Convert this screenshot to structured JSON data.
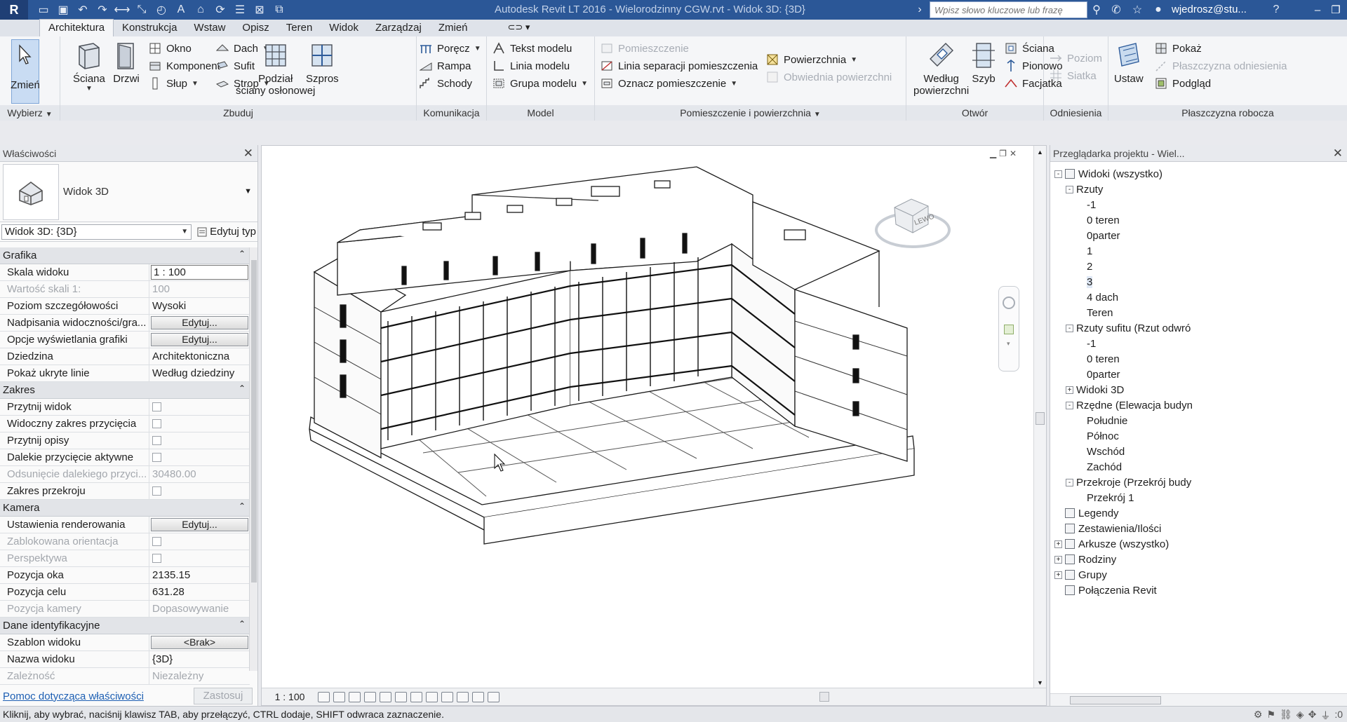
{
  "titlebar": {
    "logo": "R",
    "title": "Autodesk Revit LT 2016 -    Wielorodzinny CGW.rvt - Widok 3D: {3D}",
    "search_placeholder": "Wpisz słowo kluczowe lub frazę",
    "user": "wjedrosz@stu...",
    "quick_access_icons": [
      "open-icon",
      "save-icon",
      "undo-icon",
      "redo-icon",
      "measure-icon",
      "dimension-icon",
      "tag-icon",
      "text-icon",
      "3d-view-icon",
      "sync-icon",
      "thin-lines-icon",
      "close-hidden-icon",
      "switch-windows-icon"
    ],
    "help": "?"
  },
  "ribbon_tabs": [
    "Architektura",
    "Konstrukcja",
    "Wstaw",
    "Opisz",
    "Teren",
    "Widok",
    "Zarządzaj",
    "Zmień"
  ],
  "ribbon_tab_extra": "⊂⊃ ▾",
  "ribbon": {
    "select": {
      "modify_label": "Zmień",
      "group_label": "Wybierz"
    },
    "build": {
      "group_label": "Zbuduj",
      "wall": "Ściana",
      "door": "Drzwi",
      "window": "Okno",
      "component": "Komponent",
      "column": "Słup",
      "roof": "Dach",
      "ceiling": "Sufit",
      "floor": "Strop",
      "curtain_system": "Podział",
      "curtain_system_2": "ściany osłonowej",
      "curtain_grid": "Szpros"
    },
    "circulation": {
      "group_label": "Komunikacja",
      "railing": "Poręcz",
      "ramp": "Rampa",
      "stair": "Schody"
    },
    "model": {
      "group_label": "Model",
      "model_text": "Tekst modelu",
      "model_line": "Linia modelu",
      "model_group": "Grupa modelu"
    },
    "room_area": {
      "group_label": "Pomieszczenie i powierzchnia",
      "room": "Pomieszczenie",
      "room_separator": "Linia separacji  pomieszczenia",
      "tag_room": "Oznacz  pomieszczenie",
      "area": "Powierzchnia",
      "area_boundary": "Obwiednia  powierzchni"
    },
    "opening": {
      "group_label": "Otwór",
      "by_face": "Według",
      "by_face_2": "powierzchni",
      "shaft": "Szyb",
      "wall": "Ściana",
      "vertical": "Pionowo",
      "dormer": "Facjatka"
    },
    "datum": {
      "group_label": "Odniesienia",
      "level": "Poziom",
      "grid": "Siatka"
    },
    "work_plane": {
      "group_label": "Płaszczyzna robocza",
      "set": "Ustaw",
      "show": "Pokaż",
      "ref_plane": "Płaszczyzna odniesienia",
      "viewer": "Podgląd"
    }
  },
  "properties": {
    "header": "Właściwości",
    "type_name": "Widok 3D",
    "view_selector": "Widok 3D: {3D}",
    "edit_type": "Edytuj typ",
    "sections": [
      {
        "title": "Grafika",
        "rows": [
          {
            "name": "Skala widoku",
            "value": "1 : 100",
            "kind": "input"
          },
          {
            "name": "Wartość skali    1:",
            "value": "100",
            "kind": "text",
            "dim": true
          },
          {
            "name": "Poziom szczegółowości",
            "value": "Wysoki",
            "kind": "text"
          },
          {
            "name": "Nadpisania widoczności/gra...",
            "value": "Edytuj...",
            "kind": "button"
          },
          {
            "name": "Opcje wyświetlania grafiki",
            "value": "Edytuj...",
            "kind": "button"
          },
          {
            "name": "Dziedzina",
            "value": "Architektoniczna",
            "kind": "text"
          },
          {
            "name": "Pokaż ukryte linie",
            "value": "Według dziedziny",
            "kind": "text"
          }
        ]
      },
      {
        "title": "Zakres",
        "rows": [
          {
            "name": "Przytnij widok",
            "value": "",
            "kind": "check"
          },
          {
            "name": "Widoczny zakres przycięcia",
            "value": "",
            "kind": "check"
          },
          {
            "name": "Przytnij opisy",
            "value": "",
            "kind": "check"
          },
          {
            "name": "Dalekie przycięcie aktywne",
            "value": "",
            "kind": "check"
          },
          {
            "name": "Odsunięcie dalekiego przyci...",
            "value": "30480.00",
            "kind": "text",
            "dim": true
          },
          {
            "name": "Zakres przekroju",
            "value": "",
            "kind": "check"
          }
        ]
      },
      {
        "title": "Kamera",
        "rows": [
          {
            "name": "Ustawienia renderowania",
            "value": "Edytuj...",
            "kind": "button"
          },
          {
            "name": "Zablokowana orientacja",
            "value": "",
            "kind": "check",
            "dim": true
          },
          {
            "name": "Perspektywa",
            "value": "",
            "kind": "check",
            "dim": true
          },
          {
            "name": "Pozycja oka",
            "value": "2135.15",
            "kind": "text"
          },
          {
            "name": "Pozycja celu",
            "value": "631.28",
            "kind": "text"
          },
          {
            "name": "Pozycja kamery",
            "value": "Dopasowywanie",
            "kind": "text",
            "dim": true
          }
        ]
      },
      {
        "title": "Dane identyfikacyjne",
        "rows": [
          {
            "name": "Szablon widoku",
            "value": "<Brak>",
            "kind": "button"
          },
          {
            "name": "Nazwa widoku",
            "value": "{3D}",
            "kind": "text"
          },
          {
            "name": "Zależność",
            "value": "Niezależny",
            "kind": "text",
            "dim": true
          }
        ]
      }
    ],
    "help_link": "Pomoc dotycząca właściwości",
    "apply": "Zastosuj"
  },
  "viewport": {
    "viewcube_label": "LEWO",
    "scale": "1 : 100",
    "view_controls": [
      "detail-level-icon",
      "visual-style-icon",
      "sun-path-icon",
      "shadows-icon",
      "render-icon",
      "crop-icon",
      "show-crop-icon",
      "unlock-view-icon",
      "temp-hide-icon",
      "reveal-hidden-icon",
      "analytical-icon",
      "highlight-icon"
    ]
  },
  "browser": {
    "header": "Przeglądarka projektu - Wiel...",
    "tree": [
      {
        "label": "Widoki (wszystko)",
        "depth": 0,
        "toggle": "-",
        "icon": true
      },
      {
        "label": "Rzuty",
        "depth": 1,
        "toggle": "-"
      },
      {
        "label": "-1",
        "depth": 2
      },
      {
        "label": "0 teren",
        "depth": 2
      },
      {
        "label": "0parter",
        "depth": 2
      },
      {
        "label": "1",
        "depth": 2
      },
      {
        "label": "2",
        "depth": 2
      },
      {
        "label": "3",
        "depth": 2,
        "selected": true
      },
      {
        "label": "4 dach",
        "depth": 2
      },
      {
        "label": "Teren",
        "depth": 2
      },
      {
        "label": "Rzuty sufitu (Rzut odwró",
        "depth": 1,
        "toggle": "-"
      },
      {
        "label": "-1",
        "depth": 2
      },
      {
        "label": "0 teren",
        "depth": 2
      },
      {
        "label": "0parter",
        "depth": 2
      },
      {
        "label": "Widoki 3D",
        "depth": 1,
        "toggle": "+"
      },
      {
        "label": "Rzędne (Elewacja budyn",
        "depth": 1,
        "toggle": "-"
      },
      {
        "label": "Południe",
        "depth": 2
      },
      {
        "label": "Północ",
        "depth": 2
      },
      {
        "label": "Wschód",
        "depth": 2
      },
      {
        "label": "Zachód",
        "depth": 2
      },
      {
        "label": "Przekroje (Przekrój budy",
        "depth": 1,
        "toggle": "-"
      },
      {
        "label": "Przekrój 1",
        "depth": 2
      },
      {
        "label": "Legendy",
        "depth": 0,
        "icon": true
      },
      {
        "label": "Zestawienia/Ilości",
        "depth": 0,
        "icon": true
      },
      {
        "label": "Arkusze (wszystko)",
        "depth": 0,
        "toggle": "+",
        "icon": true
      },
      {
        "label": "Rodziny",
        "depth": 0,
        "toggle": "+",
        "icon": true
      },
      {
        "label": "Grupy",
        "depth": 0,
        "toggle": "+",
        "icon": true
      },
      {
        "label": "Połączenia Revit",
        "depth": 0,
        "icon": true
      }
    ]
  },
  "status": {
    "text": "Kliknij, aby wybrać, naciśnij klawisz TAB, aby przełączyć, CTRL dodaje, SHIFT odwraca zaznaczenie.",
    "filter_count": ":0"
  }
}
